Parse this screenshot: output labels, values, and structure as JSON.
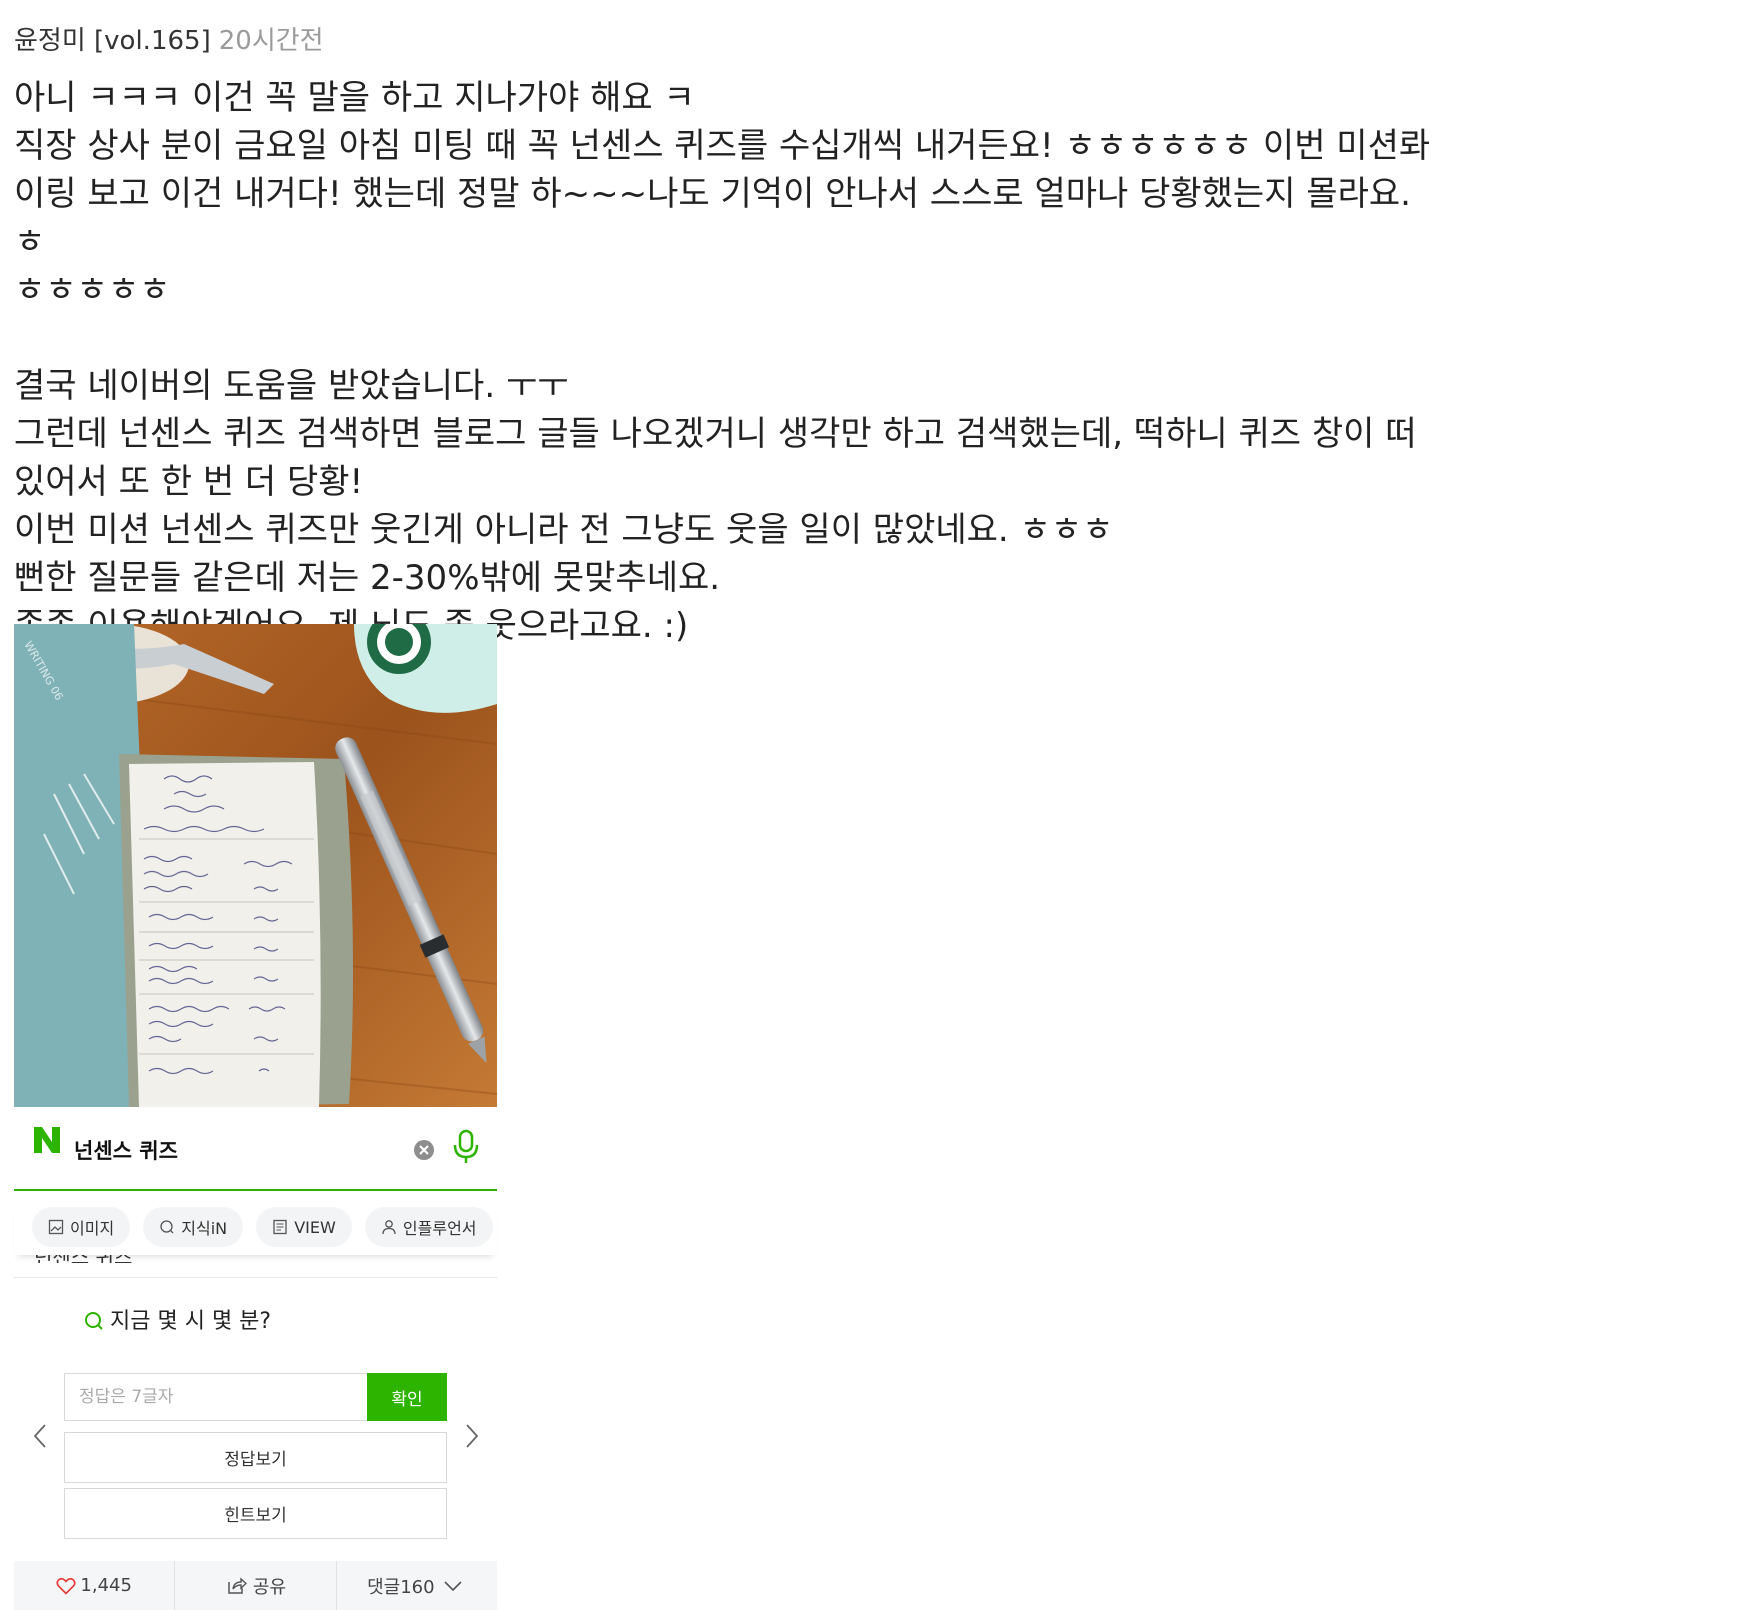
{
  "post": {
    "author": "윤정미 [vol.165]",
    "time": "20시간전",
    "lines": [
      "아니 ㅋㅋㅋ 이건 꼭 말을 하고 지나가야 해요 ㅋ",
      "직장 상사 분이 금요일 아침 미팅 때 꼭 넌센스 퀴즈를 수십개씩 내거든요! ㅎㅎㅎㅎㅎㅎ 이번 미션롸",
      "이링 보고 이건 내거다! 했는데 정말 하~~~나도 기억이 안나서 스스로 얼마나 당황했는지 몰라요. ㅎ",
      "ㅎㅎㅎㅎㅎ",
      "",
      "결국 네이버의 도움을 받았습니다. ㅜㅜ",
      "그런데 넌센스 퀴즈 검색하면 블로그 글들 나오겠거니 생각만 하고 검색했는데, 떡하니 퀴즈 창이 떠",
      "있어서 또 한 번 더 당황!",
      "이번 미션 넌센스 퀴즈만 웃긴게 아니라 전 그냥도 웃을 일이 많았네요. ㅎㅎㅎ",
      "뻔한 질문들 같은데 저는 2-30%밖에 못맞추네요.",
      "종종 이용해야겠어요. 제 뇌도 좀 웃으라고요. :)"
    ]
  },
  "search": {
    "query": "넌센스 퀴즈",
    "chips": [
      "이미지",
      "지식iN",
      "VIEW",
      "인플루언서"
    ]
  },
  "quiz": {
    "cut_off_label": "넌센스 퀴즈",
    "question": "지금 몇 시 몇 분?",
    "answer_placeholder": "정답은 7글자",
    "confirm_label": "확인",
    "show_answer_label": "정답보기",
    "hint_label": "힌트보기"
  },
  "footer": {
    "likes": "1,445",
    "share_label": "공유",
    "comments_label": "댓글160"
  },
  "colors": {
    "naver_green": "#2db400",
    "heart": "#e53935"
  },
  "icons": [
    "naver-logo",
    "clear-icon",
    "mic-icon",
    "image-icon",
    "question-icon",
    "document-icon",
    "person-icon",
    "play-icon",
    "chevron-left-icon",
    "chevron-right-icon",
    "heart-icon",
    "share-icon",
    "chevron-down-icon"
  ]
}
